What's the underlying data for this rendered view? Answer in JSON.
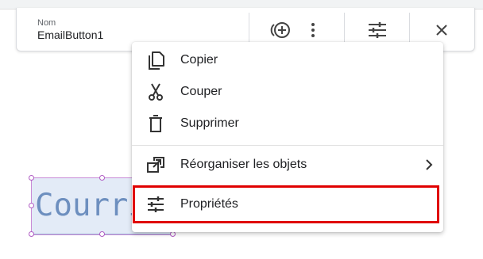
{
  "toolbar": {
    "name_caption": "Nom",
    "name_value": "EmailButton1",
    "icons": [
      "add-circle-icon",
      "more-vertical-icon",
      "tune-icon",
      "close-icon"
    ]
  },
  "widget": {
    "text": "Courri"
  },
  "menu": {
    "items": [
      {
        "label": "Copier",
        "icon": "copy-icon"
      },
      {
        "label": "Couper",
        "icon": "scissors-icon"
      },
      {
        "label": "Supprimer",
        "icon": "trash-icon"
      },
      {
        "label": "Réorganiser les objets",
        "icon": "arrange-icon",
        "has_submenu": true
      },
      {
        "label": "Propriétés",
        "icon": "tune-icon",
        "highlighted": true
      }
    ]
  },
  "colors": {
    "highlight": "#e00000",
    "selection": "#b05cc4",
    "widget_fill": "#e3ebf7",
    "widget_text": "#6d8fbf"
  }
}
